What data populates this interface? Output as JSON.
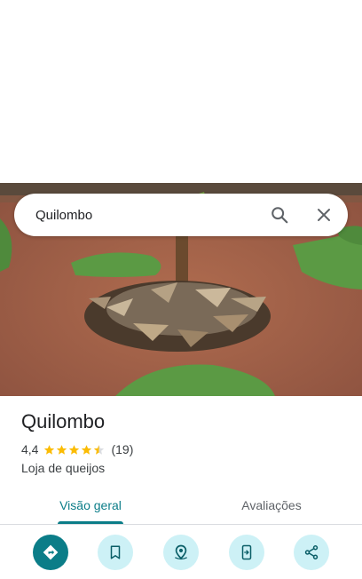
{
  "search": {
    "query": "Quilombo",
    "search_icon": "search-icon",
    "close_icon": "close-icon"
  },
  "photo": {
    "subject": "banana-tree-with-dry-leaves-photo"
  },
  "place": {
    "name": "Quilombo",
    "rating": "4,4",
    "stars_value": 4.4,
    "stars_max": 5,
    "review_count": "(19)",
    "category": "Loja de queijos"
  },
  "tabs": [
    {
      "label": "Visão geral",
      "active": true
    },
    {
      "label": "Avaliações",
      "active": false
    }
  ],
  "actions": [
    {
      "icon": "directions-icon",
      "primary": true
    },
    {
      "icon": "bookmark-icon",
      "primary": false
    },
    {
      "icon": "nearby-icon",
      "primary": false
    },
    {
      "icon": "send-to-phone-icon",
      "primary": false
    },
    {
      "icon": "share-icon",
      "primary": false
    }
  ],
  "colors": {
    "accent": "#0b7d88",
    "action_bg": "#cdf1f6",
    "star": "#fbbc04",
    "soil": "#a4634a",
    "grass": "#4f8a3c"
  }
}
